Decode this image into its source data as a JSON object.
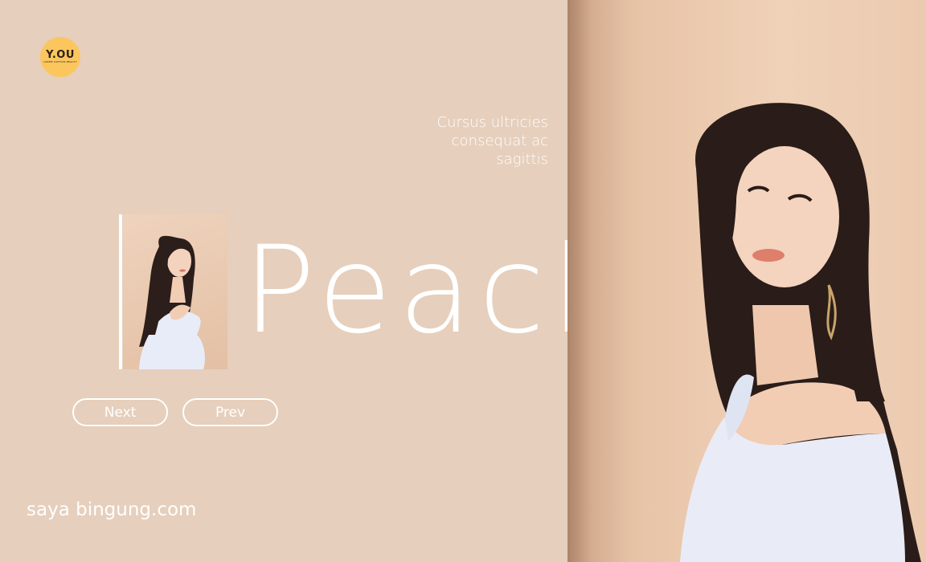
{
  "brand": {
    "logo_text": "Y.OU",
    "logo_subtext": "LOREM CAPTION BEAUTY",
    "logo_color": "#fbc65e"
  },
  "tagline": {
    "lines": [
      "Cursus ultricies",
      "consequat ac",
      "sagittis"
    ]
  },
  "headline": "Peach",
  "buttons": {
    "next_label": "Next",
    "prev_label": "Prev"
  },
  "footer": {
    "text": "saya bingung.com"
  },
  "colors": {
    "background": "#e6cfbc",
    "text": "#ffffff",
    "hero_background": "#f0d2b9"
  },
  "images": {
    "thumbnail": "woman-portrait-thumbnail",
    "hero": "woman-portrait-hero"
  }
}
